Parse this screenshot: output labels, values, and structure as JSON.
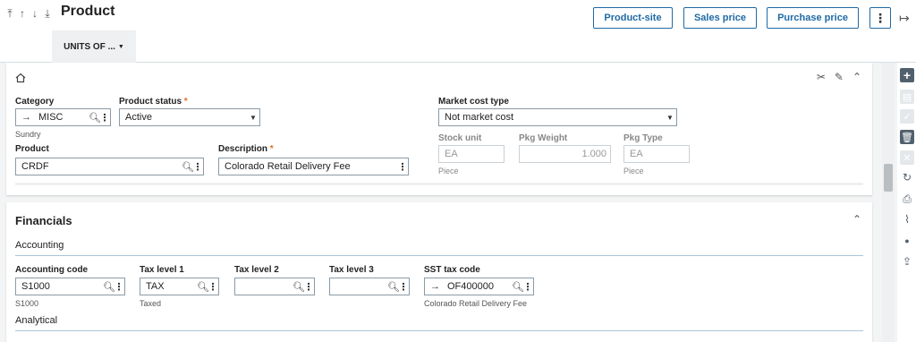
{
  "header": {
    "nav": [
      "⤒",
      "↑",
      "↓",
      "⤓"
    ],
    "title": "Product",
    "tab_label": "UNITS OF ...",
    "buttons": {
      "product_site": "Product-site",
      "sales_price": "Sales price",
      "purchase_price": "Purchase price",
      "more": "⋮"
    },
    "exit_icon": "↦"
  },
  "main_card": {
    "category": {
      "label": "Category",
      "value": "MISC",
      "sub": "Sundry"
    },
    "product_status": {
      "label": "Product status",
      "value": "Active"
    },
    "market_cost_type": {
      "label": "Market cost type",
      "value": "Not market cost"
    },
    "product": {
      "label": "Product",
      "value": "CRDF"
    },
    "description": {
      "label": "Description",
      "value": "Colorado Retail Delivery Fee"
    },
    "stock_unit": {
      "label": "Stock unit",
      "value": "EA",
      "sub": "Piece"
    },
    "pkg_weight": {
      "label": "Pkg Weight",
      "value": "1.000"
    },
    "pkg_type": {
      "label": "Pkg Type",
      "value": "EA",
      "sub": "Piece"
    },
    "required_mark": "*"
  },
  "financials": {
    "title": "Financials",
    "accounting_title": "Accounting",
    "analytical_title": "Analytical",
    "accounting_code": {
      "label": "Accounting code",
      "value": "S1000",
      "sub": "S1000"
    },
    "tax_level_1": {
      "label": "Tax level 1",
      "value": "TAX",
      "sub": "Taxed"
    },
    "tax_level_2": {
      "label": "Tax level 2",
      "value": ""
    },
    "tax_level_3": {
      "label": "Tax level 3",
      "value": ""
    },
    "sst_tax_code": {
      "label": "SST tax code",
      "value": "OF400000",
      "sub": "Colorado Retail Delivery Fee"
    }
  },
  "icons": {
    "search": "🔍︎",
    "dots": "⋮",
    "arrow": "→",
    "caret": "▼",
    "collapse": "⌃",
    "tools": "✂",
    "edit": "✎"
  },
  "rail": {
    "add": "+",
    "save": "▤",
    "ok": "✓",
    "delete": "🗑︎",
    "cancel": "✕",
    "refresh": "↻",
    "print": "⎙",
    "attach": "⌇",
    "comment": "●",
    "export": "⇪"
  },
  "colors": {
    "accent": "#1f6aa5",
    "required": "#e56a1e",
    "rail_dark": "#51606c"
  }
}
